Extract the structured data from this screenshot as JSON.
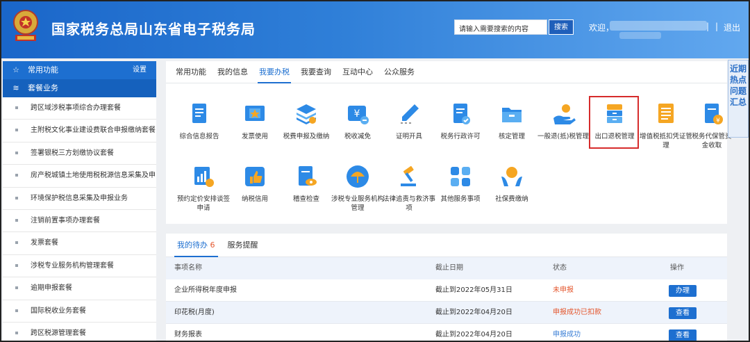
{
  "header": {
    "title": "国家税务总局山东省电子税务局",
    "search_placeholder": "请输入需要搜索的内容",
    "search_button": "搜索",
    "welcome": "欢迎，",
    "separator": "|",
    "logout": "退出"
  },
  "sidebar": {
    "common_label": "常用功能",
    "settings_label": "设置",
    "package_label": "套餐业务",
    "items": [
      "跨区域涉税事项综合办理套餐",
      "主附税文化事业建设费联合申报缴纳套餐",
      "签署银税三方划缴协议套餐",
      "房产税城镇土地使用税税源信息采集及申…",
      "环境保护税信息采集及申报业务",
      "注销前置事项办理套餐",
      "发票套餐",
      "涉税专业服务机构管理套餐",
      "逾期申报套餐",
      "国际税收业务套餐",
      "跨区税源管理套餐"
    ]
  },
  "main": {
    "tabs": [
      "常用功能",
      "我的信息",
      "我要办税",
      "我要查询",
      "互动中心",
      "公众服务"
    ],
    "active_tab": "我要办税",
    "services_row1": [
      {
        "label": "综合信息报告",
        "icon": "doc-report-icon"
      },
      {
        "label": "发票使用",
        "icon": "invoice-star-icon"
      },
      {
        "label": "税费申报及缴纳",
        "icon": "layers-yen-icon"
      },
      {
        "label": "税收减免",
        "icon": "tax-reduction-icon"
      },
      {
        "label": "证明开具",
        "icon": "pen-certificate-icon"
      },
      {
        "label": "税务行政许可",
        "icon": "doc-check-icon"
      },
      {
        "label": "核定管理",
        "icon": "folder-icon"
      },
      {
        "label": "一般退(抵)税管理",
        "icon": "hand-coin-icon"
      },
      {
        "label": "出口退税管理",
        "icon": "cabinet-icon"
      },
      {
        "label": "增值税抵扣凭证管理",
        "icon": "ledger-icon"
      },
      {
        "label": "税务代保管资金收取",
        "icon": "doc-yen-icon"
      }
    ],
    "services_row2": [
      {
        "label": "预约定价安排谈签申请",
        "icon": "chart-yen-icon"
      },
      {
        "label": "纳税信用",
        "icon": "thumb-up-icon"
      },
      {
        "label": "稽查检查",
        "icon": "doc-eye-icon"
      },
      {
        "label": "涉税专业服务机构管理",
        "icon": "umbrella-icon"
      },
      {
        "label": "法律追责与救济事项",
        "icon": "gavel-icon"
      },
      {
        "label": "其他服务事项",
        "icon": "grid-icon"
      },
      {
        "label": "社保费缴纳",
        "icon": "hands-globe-icon"
      }
    ],
    "side_tab": "近期热点问题汇总"
  },
  "todo": {
    "tab_pending": "我的待办",
    "pending_count": "6",
    "tab_reminder": "服务提醒",
    "columns": [
      "事项名称",
      "截止日期",
      "状态",
      "操作"
    ],
    "rows": [
      {
        "name": "企业所得税年度申报",
        "deadline": "截止到2022年05月31日",
        "status": "未申报",
        "action": "办理"
      },
      {
        "name": "印花税(月度)",
        "deadline": "截止到2022年04月20日",
        "status": "申报成功已扣款",
        "action": "查看"
      },
      {
        "name": "财务报表",
        "deadline": "截止到2022年04月20日",
        "status": "申报成功",
        "action": "查看"
      }
    ]
  },
  "colors": {
    "brand_blue": "#1d6fd0",
    "highlight_red": "#d62b2b",
    "status_red": "#e4572e",
    "status_blue": "#3b7fd6"
  }
}
